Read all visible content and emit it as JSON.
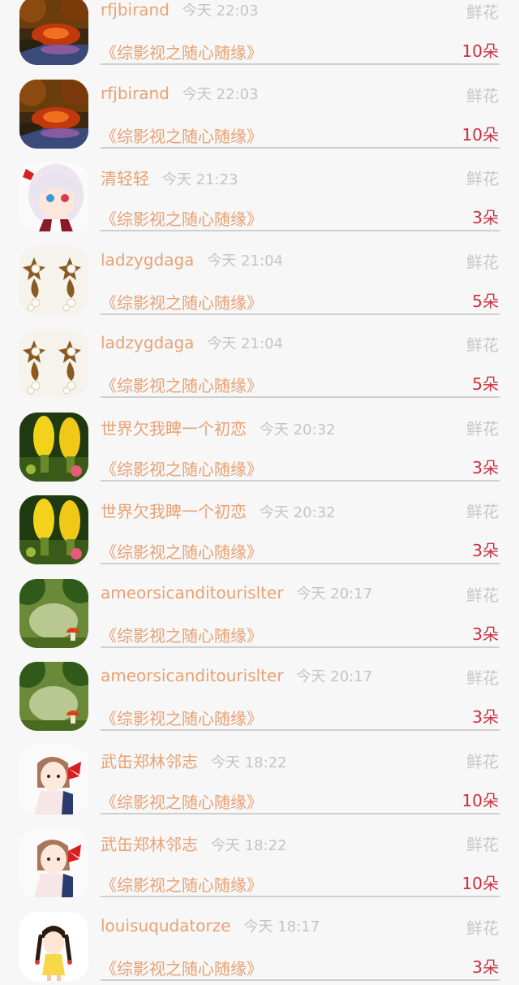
{
  "colors": {
    "username": "#e9a173",
    "time": "#c4c4c4",
    "count": "#cc3344",
    "gift_type": "#c7c7c7"
  },
  "rows": [
    {
      "avatar": "sunset-lake-avatar",
      "username": "rfjbirand",
      "time": "今天 22:03",
      "gift_type": "鲜花",
      "book": "《综影视之随心随缘》",
      "count": "10朵"
    },
    {
      "avatar": "sunset-lake-avatar",
      "username": "rfjbirand",
      "time": "今天 22:03",
      "gift_type": "鲜花",
      "book": "《综影视之随心随缘》",
      "count": "10朵"
    },
    {
      "avatar": "anime-girl-avatar",
      "username": "清轻轻",
      "time": "今天 21:23",
      "gift_type": "鲜花",
      "book": "《综影视之随心随缘》",
      "count": "3朵"
    },
    {
      "avatar": "pearl-earrings-avatar",
      "username": "ladzygdaga",
      "time": "今天 21:04",
      "gift_type": "鲜花",
      "book": "《综影视之随心随缘》",
      "count": "5朵"
    },
    {
      "avatar": "pearl-earrings-avatar",
      "username": "ladzygdaga",
      "time": "今天 21:04",
      "gift_type": "鲜花",
      "book": "《综影视之随心随缘》",
      "count": "5朵"
    },
    {
      "avatar": "cactus-avatar",
      "username": "世界欠我睥一个初恋",
      "time": "今天 20:32",
      "gift_type": "鲜花",
      "book": "《综影视之随心随缘》",
      "count": "3朵"
    },
    {
      "avatar": "cactus-avatar",
      "username": "世界欠我睥一个初恋",
      "time": "今天 20:32",
      "gift_type": "鲜花",
      "book": "《综影视之随心随缘》",
      "count": "3朵"
    },
    {
      "avatar": "forest-mushroom-avatar",
      "username": "ameorsicanditourislter",
      "time": "今天 20:17",
      "gift_type": "鲜花",
      "book": "《综影视之随心随缘》",
      "count": "3朵"
    },
    {
      "avatar": "forest-mushroom-avatar",
      "username": "ameorsicanditourislter",
      "time": "今天 20:17",
      "gift_type": "鲜花",
      "book": "《综影视之随心随缘》",
      "count": "3朵"
    },
    {
      "avatar": "bow-girl-avatar",
      "username": "武缶郑林邻志",
      "time": "今天 18:22",
      "gift_type": "鲜花",
      "book": "《综影视之随心随缘》",
      "count": "10朵"
    },
    {
      "avatar": "bow-girl-avatar",
      "username": "武缶郑林邻志",
      "time": "今天 18:22",
      "gift_type": "鲜花",
      "book": "《综影视之随心随缘》",
      "count": "10朵"
    },
    {
      "avatar": "braids-girl-avatar",
      "username": "louisuqudatorze",
      "time": "今天 18:17",
      "gift_type": "鲜花",
      "book": "《综影视之随心随缘》",
      "count": "3朵"
    }
  ]
}
